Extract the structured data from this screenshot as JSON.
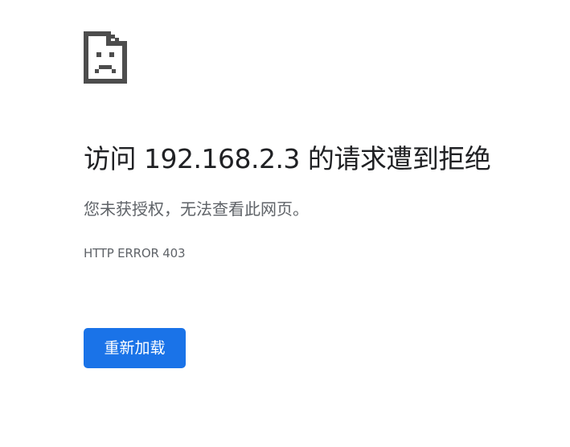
{
  "error_page": {
    "icon": "sad-page-icon",
    "title": "访问 192.168.2.3 的请求遭到拒绝",
    "message": "您未获授权，无法查看此网页。",
    "error_code": "HTTP ERROR 403",
    "reload_label": "重新加载"
  },
  "colors": {
    "title": "#202124",
    "secondary_text": "#5f6368",
    "icon": "#4d4d4d",
    "button_bg": "#1a73e8",
    "button_text": "#ffffff",
    "background": "#ffffff"
  }
}
